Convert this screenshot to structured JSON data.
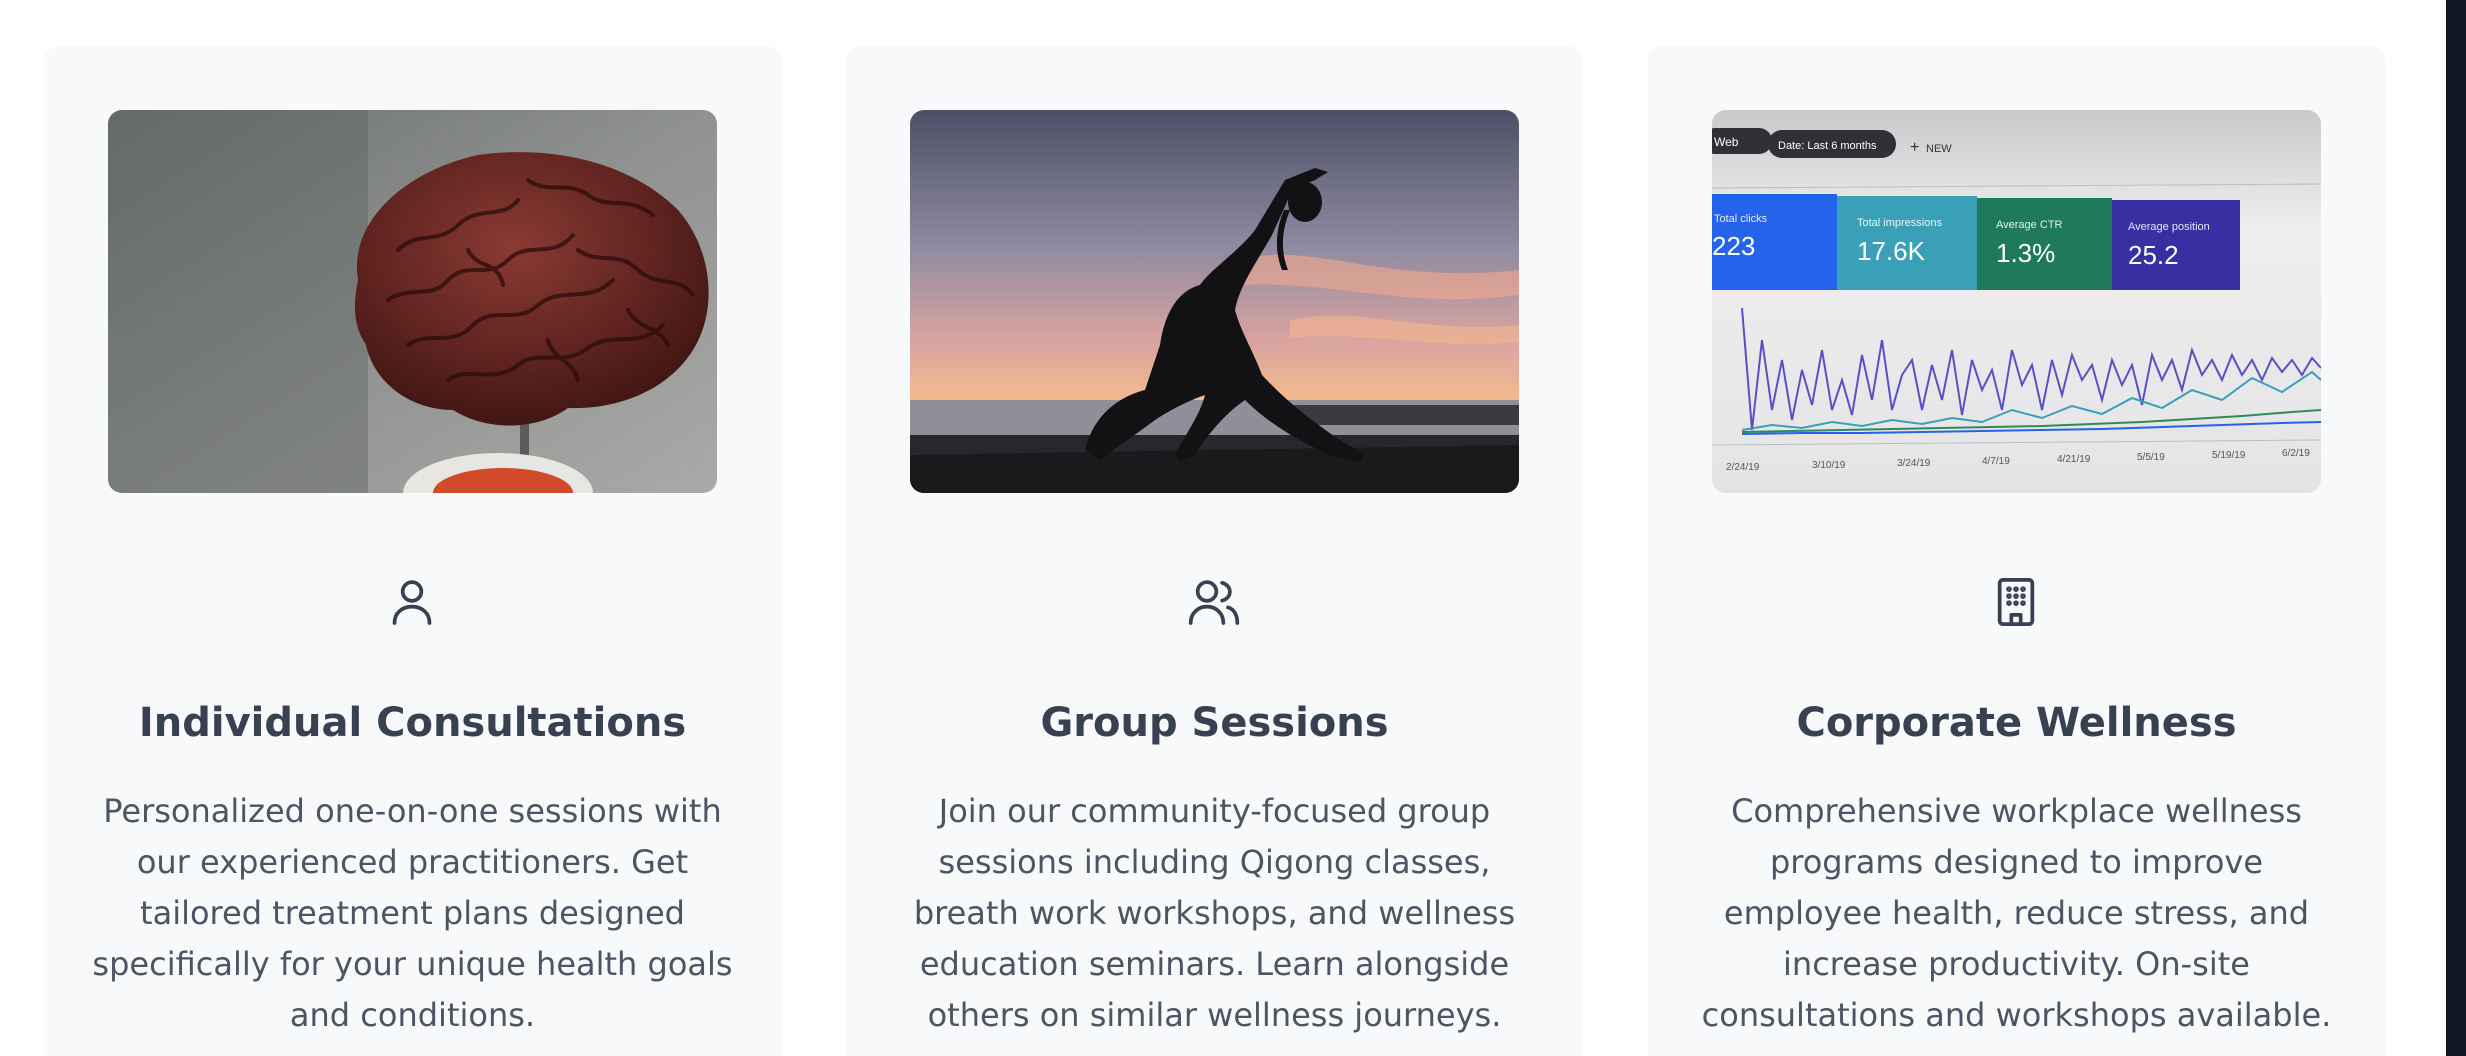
{
  "services": [
    {
      "title": "Individual Consultations",
      "description": "Personalized one-on-one sessions with our experienced practitioners. Get tailored treatment plans designed specifically for your unique health goals and conditions.",
      "icon": "user-icon"
    },
    {
      "title": "Group Sessions",
      "description": "Join our community-focused group sessions including Qigong classes, breath work workshops, and wellness education seminars. Learn alongside others on similar wellness journeys.",
      "icon": "users-icon"
    },
    {
      "title": "Corporate Wellness",
      "description": "Comprehensive workplace wellness programs designed to improve employee health, reduce stress, and increase productivity. On-site consultations and workshops available.",
      "icon": "building-icon",
      "image_dashboard": {
        "chips": [
          "Web",
          "Date: Last 6 months"
        ],
        "new_label": "NEW",
        "metrics": [
          {
            "label": "Total clicks",
            "value": "223",
            "color": "#2563eb"
          },
          {
            "label": "Total impressions",
            "value": "17.6K",
            "color": "#3aa0b8"
          },
          {
            "label": "Average CTR",
            "value": "1.3%",
            "color": "#1f7a5a"
          },
          {
            "label": "Average position",
            "value": "25.2",
            "color": "#3730a3"
          }
        ],
        "dates": [
          "2/24/19",
          "3/10/19",
          "3/24/19",
          "4/7/19",
          "4/21/19",
          "5/5/19",
          "5/19/19",
          "6/2/19"
        ]
      }
    }
  ],
  "colors": {
    "card_bg": "#f8f9fb",
    "title": "#374151",
    "text": "#4b5563",
    "edge": "#111827"
  }
}
